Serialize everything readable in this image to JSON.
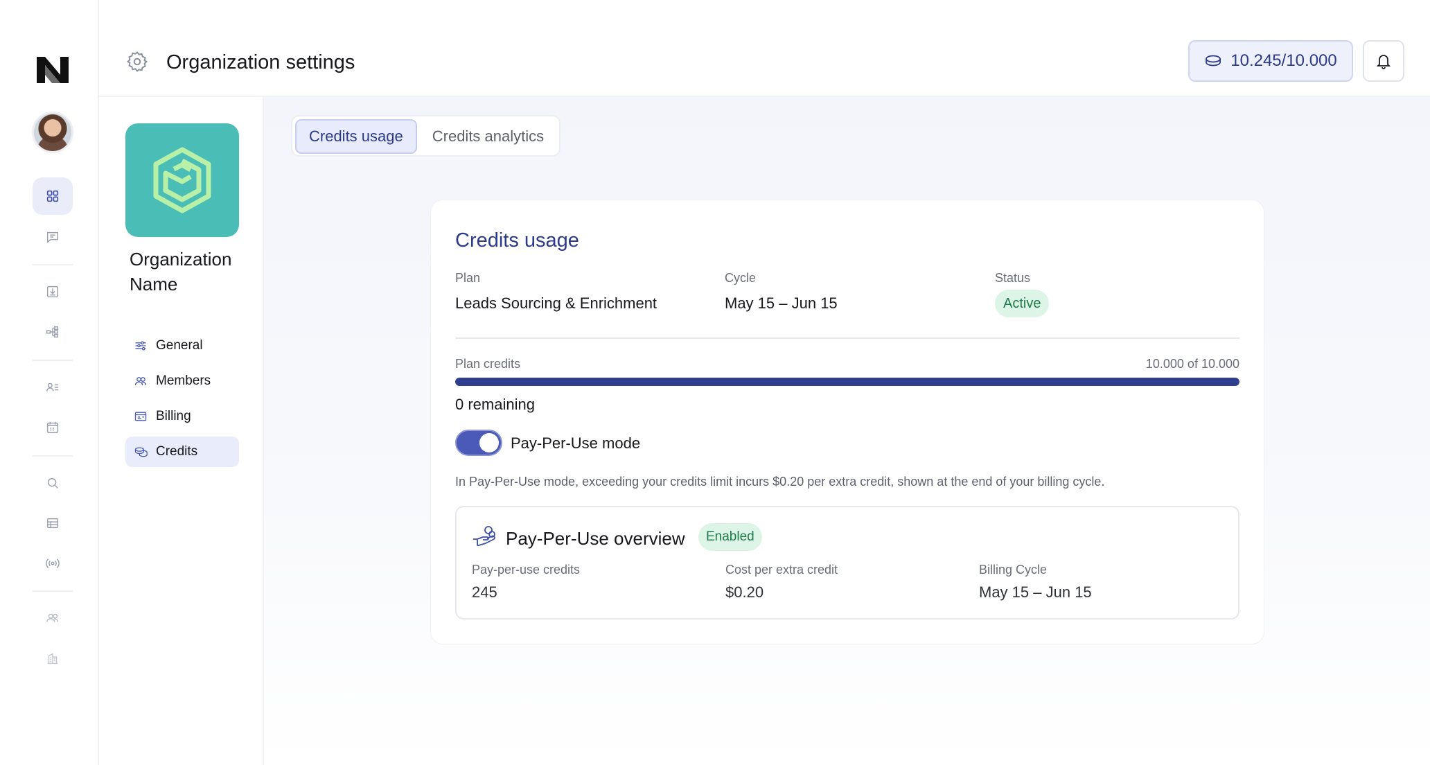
{
  "header": {
    "title": "Organization settings",
    "credits_balance": "10.245/10.000"
  },
  "rail": {
    "icons": [
      "logo-icon",
      "avatar",
      "dashboard-icon",
      "chat-icon",
      "download-icon",
      "workflow-icon",
      "contacts-list-icon",
      "calendar-icon",
      "search-icon",
      "table-icon",
      "broadcast-icon",
      "team-icon",
      "building-icon"
    ]
  },
  "org": {
    "name": "Organization Name"
  },
  "sidebar": {
    "items": [
      {
        "label": "General",
        "icon": "sliders-icon"
      },
      {
        "label": "Members",
        "icon": "members-icon"
      },
      {
        "label": "Billing",
        "icon": "billing-icon"
      },
      {
        "label": "Credits",
        "icon": "coins-icon",
        "active": true
      }
    ]
  },
  "tabs": [
    {
      "label": "Credits usage",
      "active": true
    },
    {
      "label": "Credits analytics",
      "active": false
    }
  ],
  "card": {
    "title": "Credits usage",
    "plan_label": "Plan",
    "plan_value": "Leads Sourcing & Enrichment",
    "cycle_label": "Cycle",
    "cycle_value": "May 15 – Jun 15",
    "status_label": "Status",
    "status_value": "Active",
    "plan_credits_label": "Plan credits",
    "plan_credits_value": "10.000 of 10.000",
    "plan_credits_fraction": 1.0,
    "remaining": "0 remaining",
    "ppu_toggle_label": "Pay-Per-Use mode",
    "ppu_toggle_on": true,
    "ppu_description": "In Pay-Per-Use mode, exceeding your credits limit incurs $0.20 per extra credit, shown at the end of your billing cycle."
  },
  "overview": {
    "title": "Pay-Per-Use overview",
    "badge": "Enabled",
    "ppu_credits_label": "Pay-per-use credits",
    "ppu_credits_value": "245",
    "cost_label": "Cost per extra credit",
    "cost_value": "$0.20",
    "billing_cycle_label": "Billing Cycle",
    "billing_cycle_value": "May 15 – Jun 15"
  },
  "colors": {
    "accent": "#2b3a8b",
    "org_logo_bg": "#4bbdb7",
    "success_bg": "#dcf5e6",
    "success_text": "#1f7a4a"
  }
}
